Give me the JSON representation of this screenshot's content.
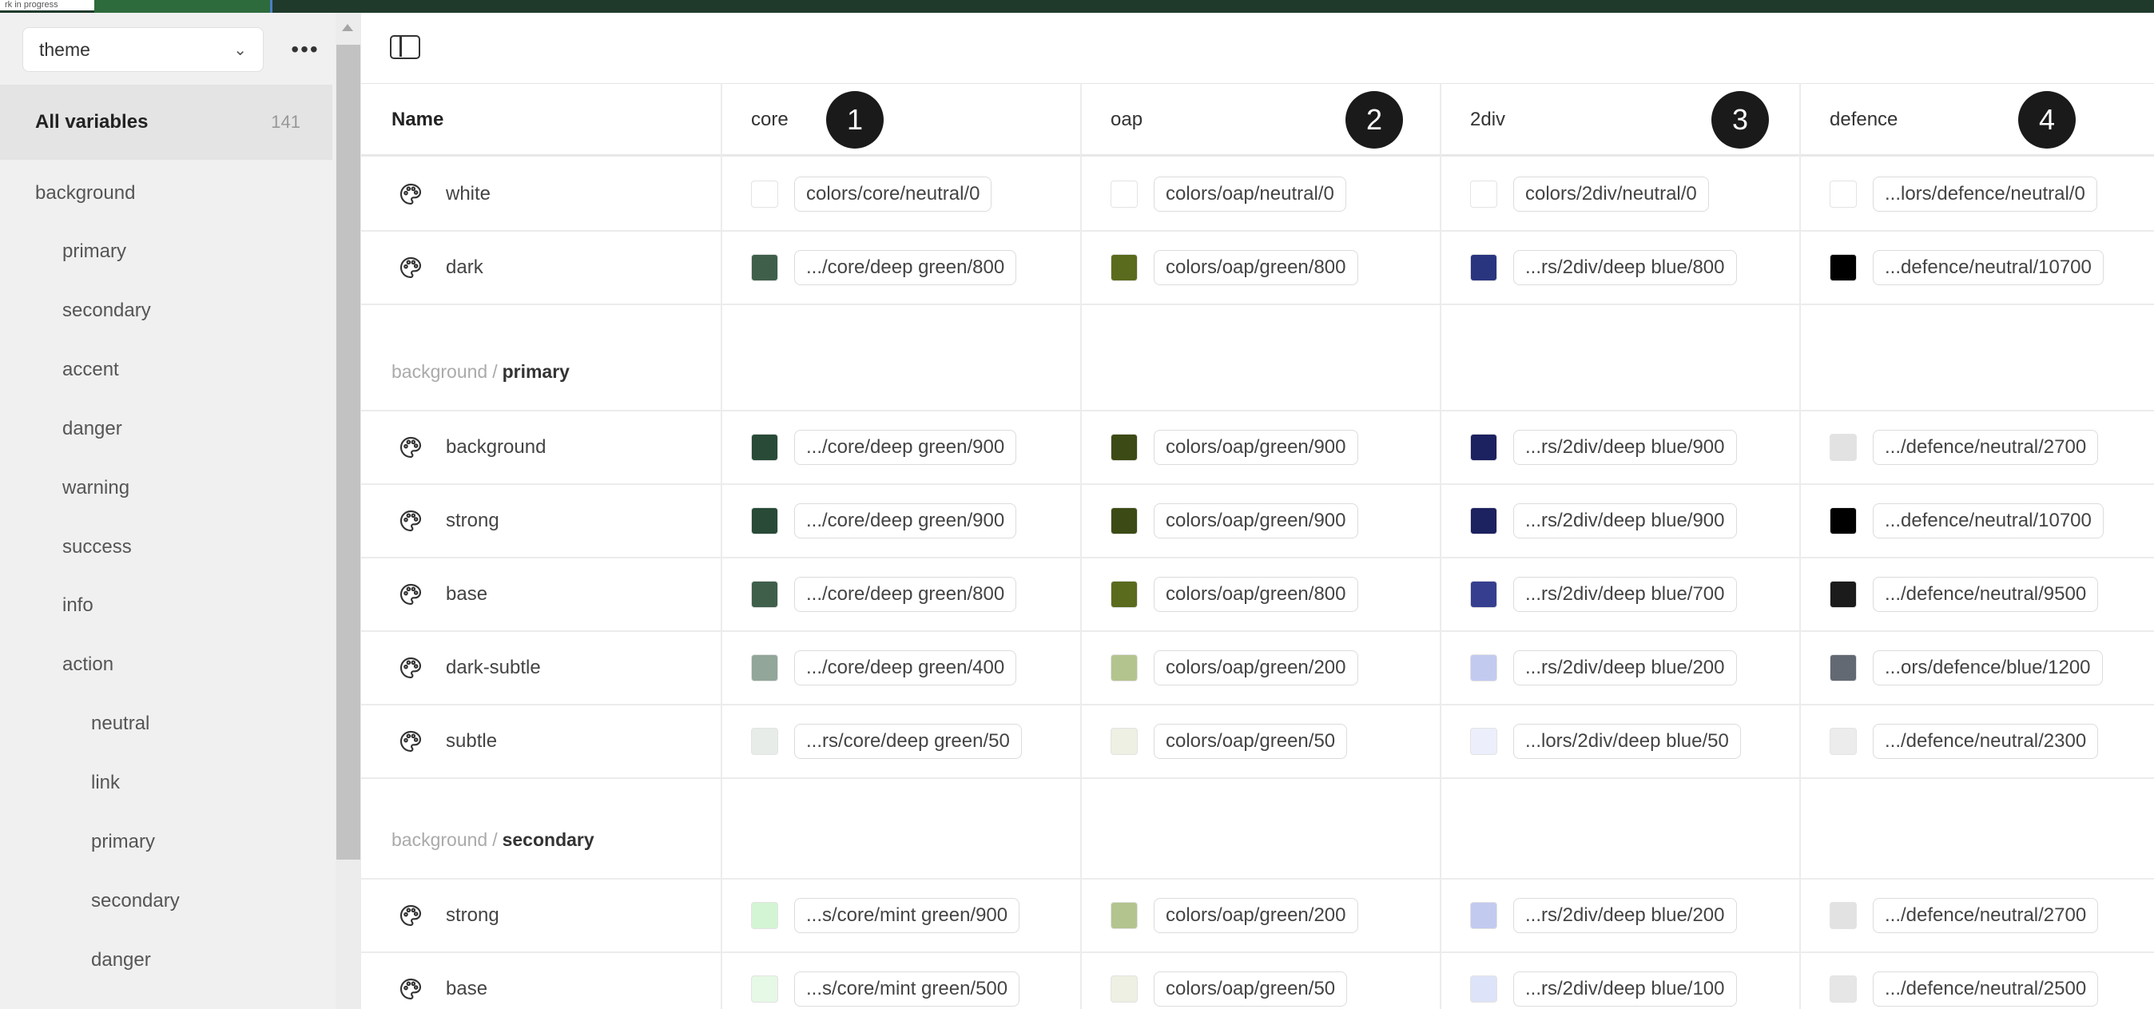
{
  "topbar": {
    "tag": "rk in progress"
  },
  "sidebar": {
    "collection": "theme",
    "more_label": "•••",
    "all_variables": {
      "label": "All variables",
      "count": "141"
    },
    "tree": [
      {
        "label": "background",
        "level": 0
      },
      {
        "label": "primary",
        "level": 1
      },
      {
        "label": "secondary",
        "level": 1
      },
      {
        "label": "accent",
        "level": 1
      },
      {
        "label": "danger",
        "level": 1
      },
      {
        "label": "warning",
        "level": 1
      },
      {
        "label": "success",
        "level": 1
      },
      {
        "label": "info",
        "level": 1
      },
      {
        "label": "action",
        "level": 1
      },
      {
        "label": "neutral",
        "level": 2
      },
      {
        "label": "link",
        "level": 2
      },
      {
        "label": "primary",
        "level": 2
      },
      {
        "label": "secondary",
        "level": 2
      },
      {
        "label": "danger",
        "level": 2
      }
    ]
  },
  "table": {
    "headers": {
      "name": "Name",
      "modes": [
        "core",
        "oap",
        "2div",
        "defence"
      ]
    },
    "badges": [
      "1",
      "2",
      "3",
      "4"
    ],
    "group_sep": "/",
    "groups": [
      {
        "parent": "",
        "child": "",
        "rows": [
          {
            "name": "white",
            "values": [
              {
                "swatch": "#ffffff",
                "alias": "colors/core/neutral/0"
              },
              {
                "swatch": "#ffffff",
                "alias": "colors/oap/neutral/0"
              },
              {
                "swatch": "#ffffff",
                "alias": "colors/2div/neutral/0"
              },
              {
                "swatch": "#ffffff",
                "alias": "...lors/defence/neutral/0"
              }
            ]
          },
          {
            "name": "dark",
            "values": [
              {
                "swatch": "#3f5f4b",
                "alias": ".../core/deep green/800"
              },
              {
                "swatch": "#5a6b1e",
                "alias": "colors/oap/green/800"
              },
              {
                "swatch": "#2a3580",
                "alias": "...rs/2div/deep blue/800"
              },
              {
                "swatch": "#000000",
                "alias": "...defence/neutral/10700"
              }
            ]
          }
        ]
      },
      {
        "parent": "background",
        "child": "primary",
        "rows": [
          {
            "name": "background",
            "values": [
              {
                "swatch": "#284a37",
                "alias": ".../core/deep green/900"
              },
              {
                "swatch": "#3c4b15",
                "alias": "colors/oap/green/900"
              },
              {
                "swatch": "#1c2160",
                "alias": "...rs/2div/deep blue/900"
              },
              {
                "swatch": "#e2e2e2",
                "alias": ".../defence/neutral/2700"
              }
            ]
          },
          {
            "name": "strong",
            "values": [
              {
                "swatch": "#284a37",
                "alias": ".../core/deep green/900"
              },
              {
                "swatch": "#3c4b15",
                "alias": "colors/oap/green/900"
              },
              {
                "swatch": "#1c2160",
                "alias": "...rs/2div/deep blue/900"
              },
              {
                "swatch": "#000000",
                "alias": "...defence/neutral/10700"
              }
            ]
          },
          {
            "name": "base",
            "values": [
              {
                "swatch": "#3f5f4b",
                "alias": ".../core/deep green/800"
              },
              {
                "swatch": "#5a6b1e",
                "alias": "colors/oap/green/800"
              },
              {
                "swatch": "#363f8f",
                "alias": "...rs/2div/deep blue/700"
              },
              {
                "swatch": "#1b1b1b",
                "alias": ".../defence/neutral/9500"
              }
            ]
          },
          {
            "name": "dark-subtle",
            "values": [
              {
                "swatch": "#92a69a",
                "alias": ".../core/deep green/400"
              },
              {
                "swatch": "#b4c48f",
                "alias": "colors/oap/green/200"
              },
              {
                "swatch": "#c3caf0",
                "alias": "...rs/2div/deep blue/200"
              },
              {
                "swatch": "#636973",
                "alias": "...ors/defence/blue/1200"
              }
            ]
          },
          {
            "name": "subtle",
            "values": [
              {
                "swatch": "#e7ece9",
                "alias": "...rs/core/deep green/50"
              },
              {
                "swatch": "#edf0e2",
                "alias": "colors/oap/green/50"
              },
              {
                "swatch": "#eceffb",
                "alias": "...lors/2div/deep blue/50"
              },
              {
                "swatch": "#ececec",
                "alias": ".../defence/neutral/2300"
              }
            ]
          }
        ]
      },
      {
        "parent": "background",
        "child": "secondary",
        "rows": [
          {
            "name": "strong",
            "values": [
              {
                "swatch": "#d3f5d3",
                "alias": "...s/core/mint green/900"
              },
              {
                "swatch": "#b4c48f",
                "alias": "colors/oap/green/200"
              },
              {
                "swatch": "#c3caf0",
                "alias": "...rs/2div/deep blue/200"
              },
              {
                "swatch": "#e2e2e2",
                "alias": ".../defence/neutral/2700"
              }
            ]
          },
          {
            "name": "base",
            "values": [
              {
                "swatch": "#e6f8e6",
                "alias": "...s/core/mint green/500"
              },
              {
                "swatch": "#edf0e2",
                "alias": "colors/oap/green/50"
              },
              {
                "swatch": "#dde3f8",
                "alias": "...rs/2div/deep blue/100"
              },
              {
                "swatch": "#e6e6e6",
                "alias": ".../defence/neutral/2500"
              }
            ]
          }
        ]
      }
    ]
  }
}
